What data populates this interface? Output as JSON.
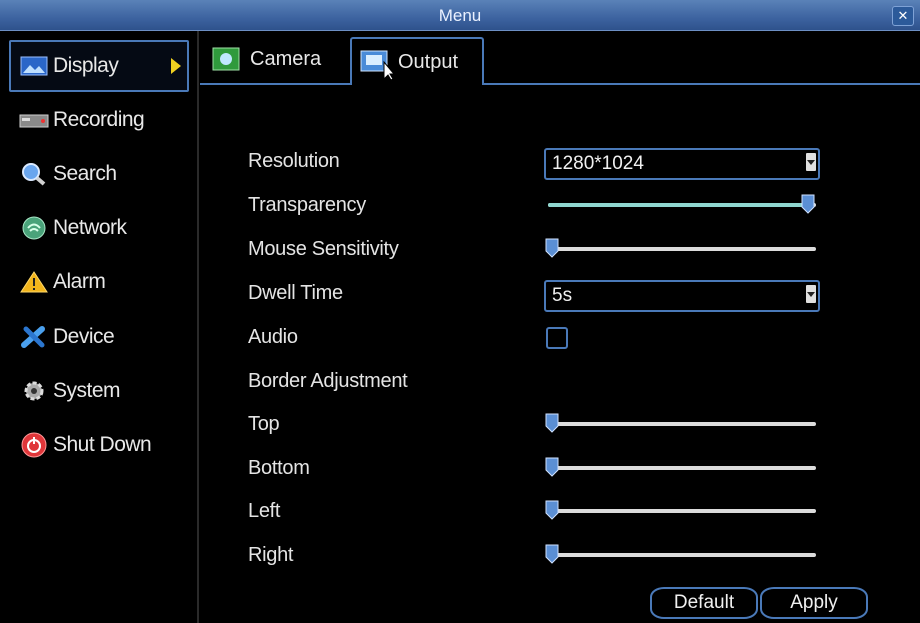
{
  "window": {
    "title": "Menu"
  },
  "sidebar": {
    "items": [
      {
        "label": "Display",
        "icon": "display-icon",
        "active": true
      },
      {
        "label": "Recording",
        "icon": "recording-icon"
      },
      {
        "label": "Search",
        "icon": "search-icon"
      },
      {
        "label": "Network",
        "icon": "network-icon"
      },
      {
        "label": "Alarm",
        "icon": "alarm-icon"
      },
      {
        "label": "Device",
        "icon": "device-icon"
      },
      {
        "label": "System",
        "icon": "system-icon"
      },
      {
        "label": "Shut Down",
        "icon": "shutdown-icon"
      }
    ]
  },
  "tabs": [
    {
      "label": "Camera",
      "icon": "camera-tab-icon"
    },
    {
      "label": "Output",
      "icon": "output-tab-icon",
      "active": true
    }
  ],
  "form": {
    "resolution": {
      "label": "Resolution",
      "value": "1280*1024"
    },
    "transparency": {
      "label": "Transparency",
      "level": 1.0
    },
    "mouse_sensitivity": {
      "label": "Mouse Sensitivity",
      "level": 0.0
    },
    "dwell_time": {
      "label": "Dwell Time",
      "value": "5s"
    },
    "audio": {
      "label": "Audio",
      "checked": false
    },
    "border_adjustment": {
      "label": "Border Adjustment"
    },
    "top": {
      "label": "Top",
      "level": 0.0
    },
    "bottom": {
      "label": "Bottom",
      "level": 0.0
    },
    "left": {
      "label": "Left",
      "level": 0.0
    },
    "right": {
      "label": "Right",
      "level": 0.0
    }
  },
  "buttons": {
    "default": "Default",
    "apply": "Apply"
  },
  "colors": {
    "accent": "#4a79b8",
    "titlebar": "#3d63a0",
    "arrow": "#f0d020",
    "fill": "#8fd6cf"
  }
}
